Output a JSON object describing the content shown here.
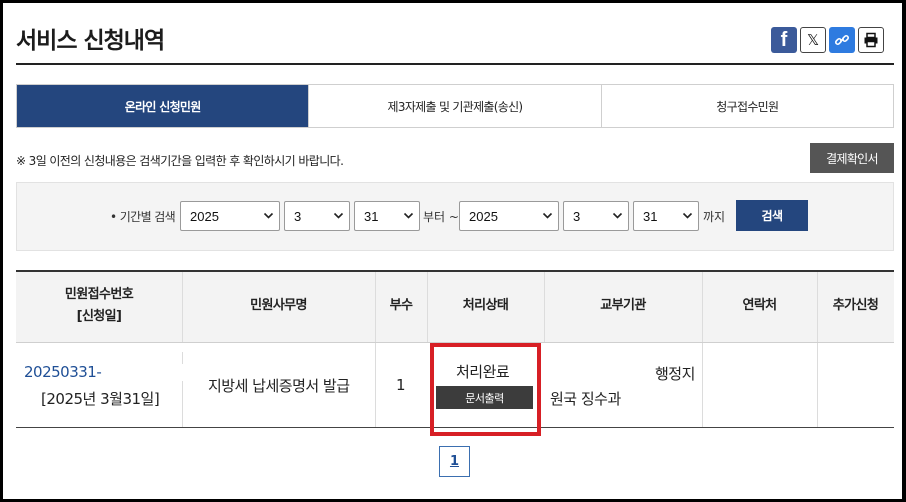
{
  "page": {
    "title": "서비스 신청내역"
  },
  "share": {
    "facebook": "f",
    "x": "𝕏"
  },
  "tabs": [
    {
      "label": "온라인 신청민원",
      "active": true
    },
    {
      "label": "제3자제출 및 기관제출(송신)",
      "active": false
    },
    {
      "label": "청구접수민원",
      "active": false
    }
  ],
  "notice": "※ 3일 이전의 신청내용은 검색기간을 입력한 후 확인하시기 바랍니다.",
  "confirm_button": "결제확인서",
  "search": {
    "label": "• 기간별 검색",
    "from_year": "2025",
    "from_month": "3",
    "from_day": "31",
    "middle": "부터 ~",
    "to_year": "2025",
    "to_month": "3",
    "to_day": "31",
    "end": "까지",
    "button": "검색"
  },
  "table": {
    "headers": [
      "민원접수번호",
      "[신청일]",
      "민원사무명",
      "부수",
      "처리상태",
      "교부기관",
      "연락처",
      "추가신청"
    ],
    "rows": [
      {
        "receipt_no": "20250331-",
        "date": "[2025년 3월31일]",
        "service": "지방세 납세증명서 발급",
        "copies": "1",
        "status": "처리완료",
        "doc_button": "문서출력",
        "agency_line1": "행정지",
        "agency_line2": "원국 징수과",
        "contact": "",
        "extra": ""
      }
    ]
  },
  "pagination": {
    "current": "1"
  },
  "colors": {
    "primary": "#24467e",
    "highlight": "#d71f25",
    "dark_button": "#555555"
  }
}
